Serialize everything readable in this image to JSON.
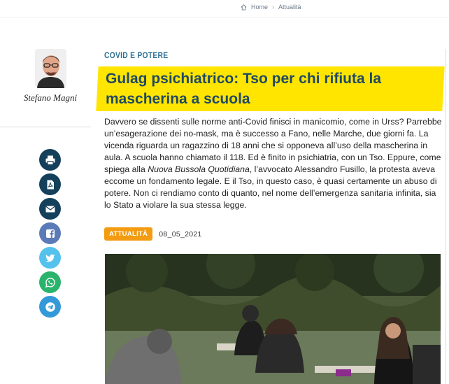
{
  "breadcrumb": {
    "home_icon": "home-icon",
    "home_label": "Home",
    "separator": "›",
    "current_label": "Attualità"
  },
  "author": {
    "name": "Stefano Magni"
  },
  "share": [
    {
      "icon": "print-icon",
      "color": "#14405b"
    },
    {
      "icon": "pdf-icon",
      "color": "#14405b"
    },
    {
      "icon": "email-icon",
      "color": "#14405b"
    },
    {
      "icon": "facebook-icon",
      "color": "#5b7bb8"
    },
    {
      "icon": "twitter-icon",
      "color": "#55c2ee"
    },
    {
      "icon": "whatsapp-icon",
      "color": "#29b36b"
    },
    {
      "icon": "telegram-icon",
      "color": "#3399d8"
    }
  ],
  "article": {
    "category": "COVID E POTERE",
    "title": "Gulag psichiatrico: Tso per chi rifiuta la mascherina a scuola",
    "lead_part1": "Davvero se dissenti sulle norme anti-Covid finisci in manicomio, come in Urss? Parrebbe un’esagerazione dei no-mask, ma è successo a Fano, nelle Marche, due giorni fa. La vicenda riguarda un ragazzino di 18 anni che si opponeva all’uso della mascherina in aula. A scuola hanno chiamato il 118. Ed è finito in psichiatria, con un Tso. Eppure, come spiega alla ",
    "lead_source": "Nuova Bussola Quotidiana",
    "lead_part2": ", l’avvocato Alessandro Fusillo, la protesta aveva eccome un fondamento legale. E il Tso, in questo caso, è quasi certamente un abuso di potere. Non ci rendiamo conto di quanto, nel nome dell’emergenza sanitaria infinita, sia lo Stato a violare la sua stessa legge.",
    "tag": "ATTUALITÀ",
    "date": "08_05_2021"
  },
  "colors": {
    "highlight": "#ffe500",
    "title": "#1f4964",
    "category": "#2c6f94",
    "tag": "#f39c12"
  }
}
